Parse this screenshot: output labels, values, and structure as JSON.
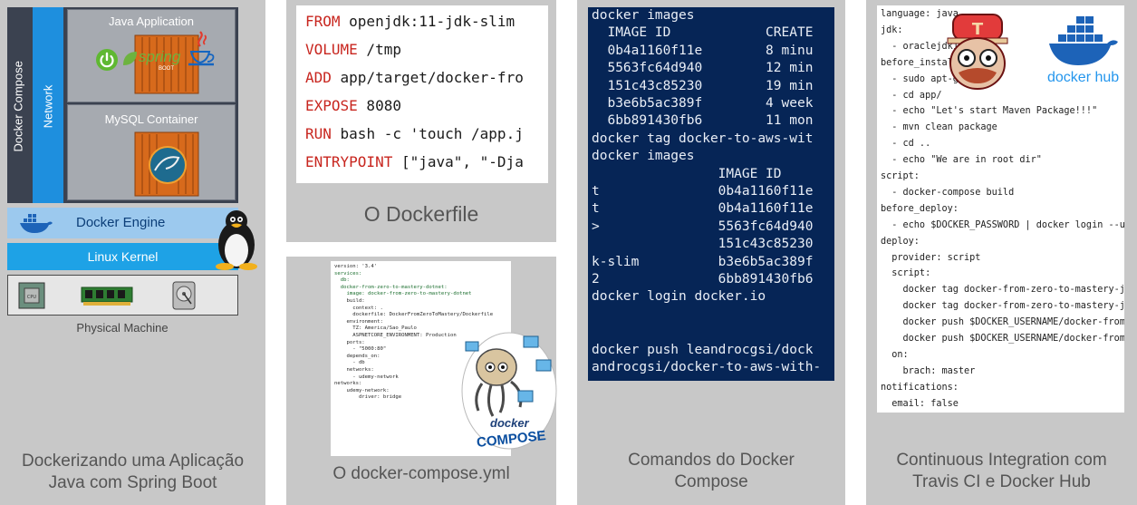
{
  "panels": [
    {
      "caption_line1": "Dockerizando uma Aplicação",
      "caption_line2": "Java com Spring Boot",
      "docker_compose_label": "Docker Compose",
      "network_label": "Network",
      "java_app_label": "Java Application",
      "boot_label": "BOOT",
      "spring_label": "spring",
      "mysql_label": "MySQL Container",
      "engine_label": "Docker Engine",
      "kernel_label": "Linux Kernel",
      "machine_label": "Physical Machine"
    },
    {
      "caption": "O Dockerfile",
      "lines": [
        {
          "kw": "FROM",
          "rest": " openjdk:11-jdk-slim"
        },
        {
          "kw": "VOLUME",
          "rest": " /tmp"
        },
        {
          "kw": "ADD",
          "rest": " app/target/docker-fro"
        },
        {
          "kw": "EXPOSE",
          "rest": " 8080"
        },
        {
          "kw": "RUN",
          "rest": " bash -c 'touch /app.j"
        },
        {
          "kw": "ENTRYPOINT",
          "rest": " [\"java\", \"-Dja"
        }
      ]
    },
    {
      "caption": "O docker-compose.yml",
      "logo_docker": "docker",
      "logo_compose": "COMPOSE",
      "yaml": [
        "version: '3.4'",
        "services:",
        "  db:",
        "  docker-from-zero-to-mastery-dotnet:",
        "    image: docker-from-zero-to-mastery-dotnet",
        "    build:",
        "      context: .",
        "      dockerfile: DockerFromZeroToMastery/Dockerfile",
        "    environment:",
        "      TZ: America/Sao_Paulo",
        "      ASPNETCORE_ENVIRONMENT: Production",
        "    ports:",
        "      - \"5000:80\"",
        "    depends_on:",
        "      - db",
        "    networks:",
        "      - udemy-network",
        "networks:",
        "    udemy-network:",
        "        driver: bridge"
      ]
    },
    {
      "caption_line1": "Comandos do Docker",
      "caption_line2": "Compose",
      "terminal": [
        "docker images",
        "  IMAGE ID            CREATE",
        "  0b4a1160f11e        8 minu",
        "  5563fc64d940        12 min",
        "  151c43c85230        19 min",
        "  b3e6b5ac389f        4 week",
        "  6bb891430fb6        11 mon",
        "docker tag docker-to-aws-wit",
        "docker images",
        "                IMAGE ID",
        "t               0b4a1160f11e",
        "t               0b4a1160f11e",
        ">               5563fc64d940",
        "                151c43c85230",
        "k-slim          b3e6b5ac389f",
        "2               6bb891430fb6",
        "docker login docker.io",
        "",
        "",
        "docker push leandrocgsi/dock",
        "androcgsi/docker-to-aws-with-"
      ]
    },
    {
      "caption_line1": "Continuous Integration com",
      "caption_line2": "Travis CI e Docker Hub",
      "docker_hub_label": "docker hub",
      "travis": [
        "language: java",
        "jdk:",
        "  - oraclejdk11",
        "before_install:",
        "  - sudo apt-get up",
        "  - cd app/",
        "  - echo \"Let's start Maven Package!!!\"",
        "  - mvn clean package",
        "  - cd ..",
        "  - echo \"We are in root dir\"",
        "script:",
        "  - docker-compose build",
        "before_deploy:",
        "  - echo $DOCKER_PASSWORD | docker login --us",
        "deploy:",
        "  provider: script",
        "  script:",
        "    docker tag docker-from-zero-to-mastery-ja",
        "    docker tag docker-from-zero-to-mastery-ja",
        "    docker push $DOCKER_USERNAME/docker-from-",
        "    docker push $DOCKER_USERNAME/docker-from-",
        "  on:",
        "    brach: master",
        "notifications:",
        "  email: false"
      ]
    }
  ]
}
